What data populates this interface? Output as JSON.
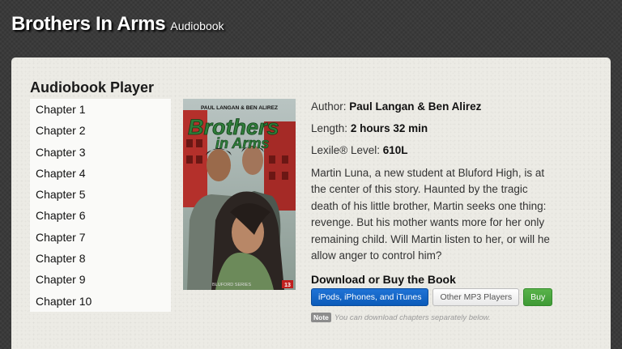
{
  "header": {
    "title": "Brothers In Arms",
    "subtitle": "Audiobook"
  },
  "player": {
    "title": "Audiobook Player",
    "chapters": [
      "Chapter 1",
      "Chapter 2",
      "Chapter 3",
      "Chapter 4",
      "Chapter 5",
      "Chapter 6",
      "Chapter 7",
      "Chapter 8",
      "Chapter 9",
      "Chapter 10"
    ]
  },
  "cover": {
    "authors": "PAUL LANGAN & BEN ALIREZ",
    "title_line1": "Brothers",
    "title_line2": "in Arms",
    "series": "BLUFORD SERIES",
    "badge": "13"
  },
  "book": {
    "author_label": "Author:",
    "author": "Paul Langan & Ben Alirez",
    "length_label": "Length:",
    "length": "2 hours 32 min",
    "lexile_label": "Lexile® Level:",
    "lexile": "610L",
    "description": "Martin Luna, a new student at Bluford High, is at the center of this story. Haunted by the tragic death of his little brother, Martin seeks one thing: revenge. But his mother wants more for her only remaining child. Will Martin listen to her, or will he allow anger to control him?"
  },
  "download": {
    "title": "Download or Buy the Book",
    "buttons": {
      "ipods": "iPods, iPhones, and iTunes",
      "mp3": "Other MP3 Players",
      "buy": "Buy"
    },
    "note_badge": "Note",
    "note_text": "You can download chapters separately below."
  },
  "colors": {
    "accent_blue": "#0c5bb9",
    "buy_green": "#3f9a35",
    "panel": "#ecebe5",
    "background": "#3a3a3a"
  }
}
